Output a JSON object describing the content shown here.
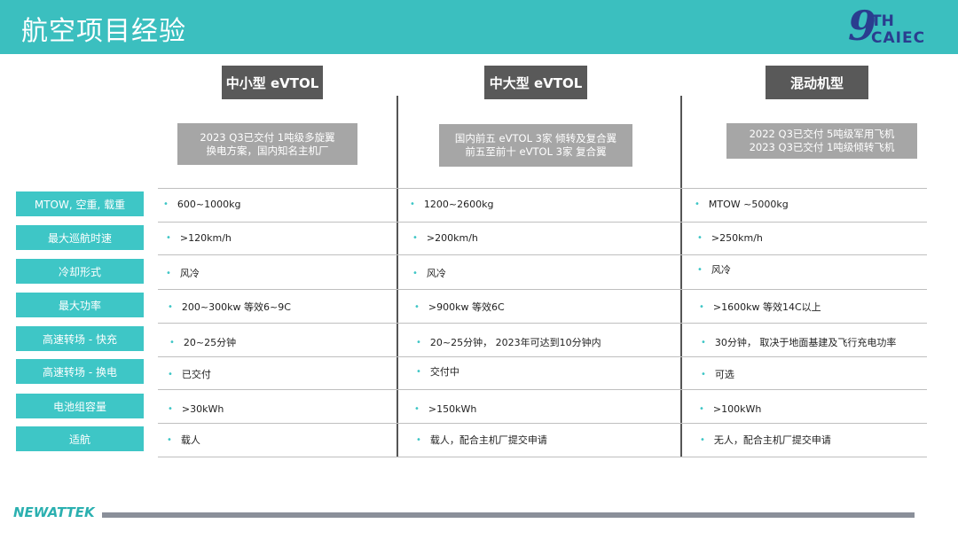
{
  "header": {
    "title": "航空项目经验",
    "logo_num": "9",
    "logo_th": "TH",
    "logo_caiec": "CAIEC"
  },
  "columns": [
    {
      "head": "中小型 eVTOL",
      "note_lines": [
        "2023 Q3已交付 1吨级多旋翼",
        "换电方案，国内知名主机厂"
      ]
    },
    {
      "head": "中大型 eVTOL",
      "note_lines": [
        "国内前五 eVTOL  3家  倾转及复合翼",
        "前五至前十 eVTOL  3家 复合翼"
      ]
    },
    {
      "head": "混动机型",
      "note_lines": [
        "2022 Q3已交付 5吨级军用飞机",
        "2023 Q3已交付 1吨级倾转飞机"
      ]
    }
  ],
  "rows": [
    {
      "label": "MTOW, 空重, 载重",
      "cells": [
        "600~1000kg",
        "1200~2600kg",
        "MTOW ~5000kg"
      ]
    },
    {
      "label": "最大巡航时速",
      "cells": [
        ">120km/h",
        ">200km/h",
        ">250km/h"
      ]
    },
    {
      "label": "冷却形式",
      "cells": [
        "风冷",
        "风冷",
        "风冷"
      ]
    },
    {
      "label": "最大功率",
      "cells": [
        "200~300kw  等效6~9C",
        ">900kw 等效6C",
        ">1600kw 等效14C以上"
      ]
    },
    {
      "label": "高速转场 - 快充",
      "cells": [
        "20~25分钟",
        "20~25分钟， 2023年可达到10分钟内",
        "30分钟， 取决于地面基建及飞行充电功率"
      ]
    },
    {
      "label": "高速转场 - 换电",
      "cells": [
        "已交付",
        "交付中",
        "可选"
      ]
    },
    {
      "label": "电池组容量",
      "cells": [
        ">30kWh",
        ">150kWh",
        ">100kWh"
      ]
    },
    {
      "label": "适航",
      "cells": [
        "载人",
        "载人，配合主机厂提交申请",
        "无人，配合主机厂提交申请"
      ]
    }
  ],
  "footer": {
    "brand": "NEWATTEK"
  },
  "colors": {
    "teal": "#3bbfbf",
    "dark_header": "#595959",
    "note_gray": "#a6a6a6",
    "logo_blue": "#2a3d8f"
  }
}
